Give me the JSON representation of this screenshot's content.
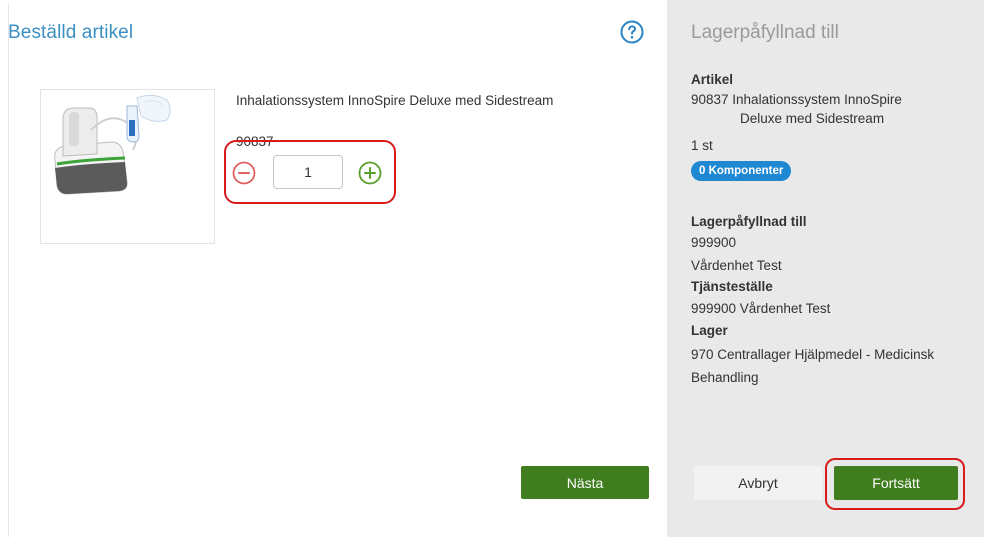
{
  "left": {
    "title": "Beställd artikel",
    "product": {
      "name": "Inhalationssystem InnoSpire Deluxe med Sidestream",
      "number": "90837",
      "quantity": "1"
    },
    "next_label": "Nästa"
  },
  "right": {
    "title": "Lagerpåfyllnad till",
    "article_heading": "Artikel",
    "article_line1": "90837 Inhalationssystem InnoSpire",
    "article_line2": "Deluxe med Sidestream",
    "article_qty": "1 st",
    "components_badge": "0 Komponenter",
    "refill_heading": "Lagerpåfyllnad till",
    "refill_code": "999900",
    "refill_name": "Vårdenhet Test",
    "service_heading": "Tjänsteställe",
    "service_value": "999900 Vårdenhet Test",
    "stock_heading": "Lager",
    "stock_line1": "970 Centrallager Hjälpmedel - Medicinsk",
    "stock_line2": "Behandling",
    "cancel_label": "Avbryt",
    "continue_label": "Fortsätt"
  },
  "colors": {
    "title_blue": "#3b8fc2",
    "primary_green": "#3f7d1f",
    "badge_blue": "#1e88d2",
    "highlight_red": "#d81c1c",
    "minus_red": "#e06060",
    "plus_green": "#5aa02c"
  },
  "icons": {
    "help": "question-circle-icon",
    "minus": "minus-circle-icon",
    "plus": "plus-circle-icon"
  }
}
